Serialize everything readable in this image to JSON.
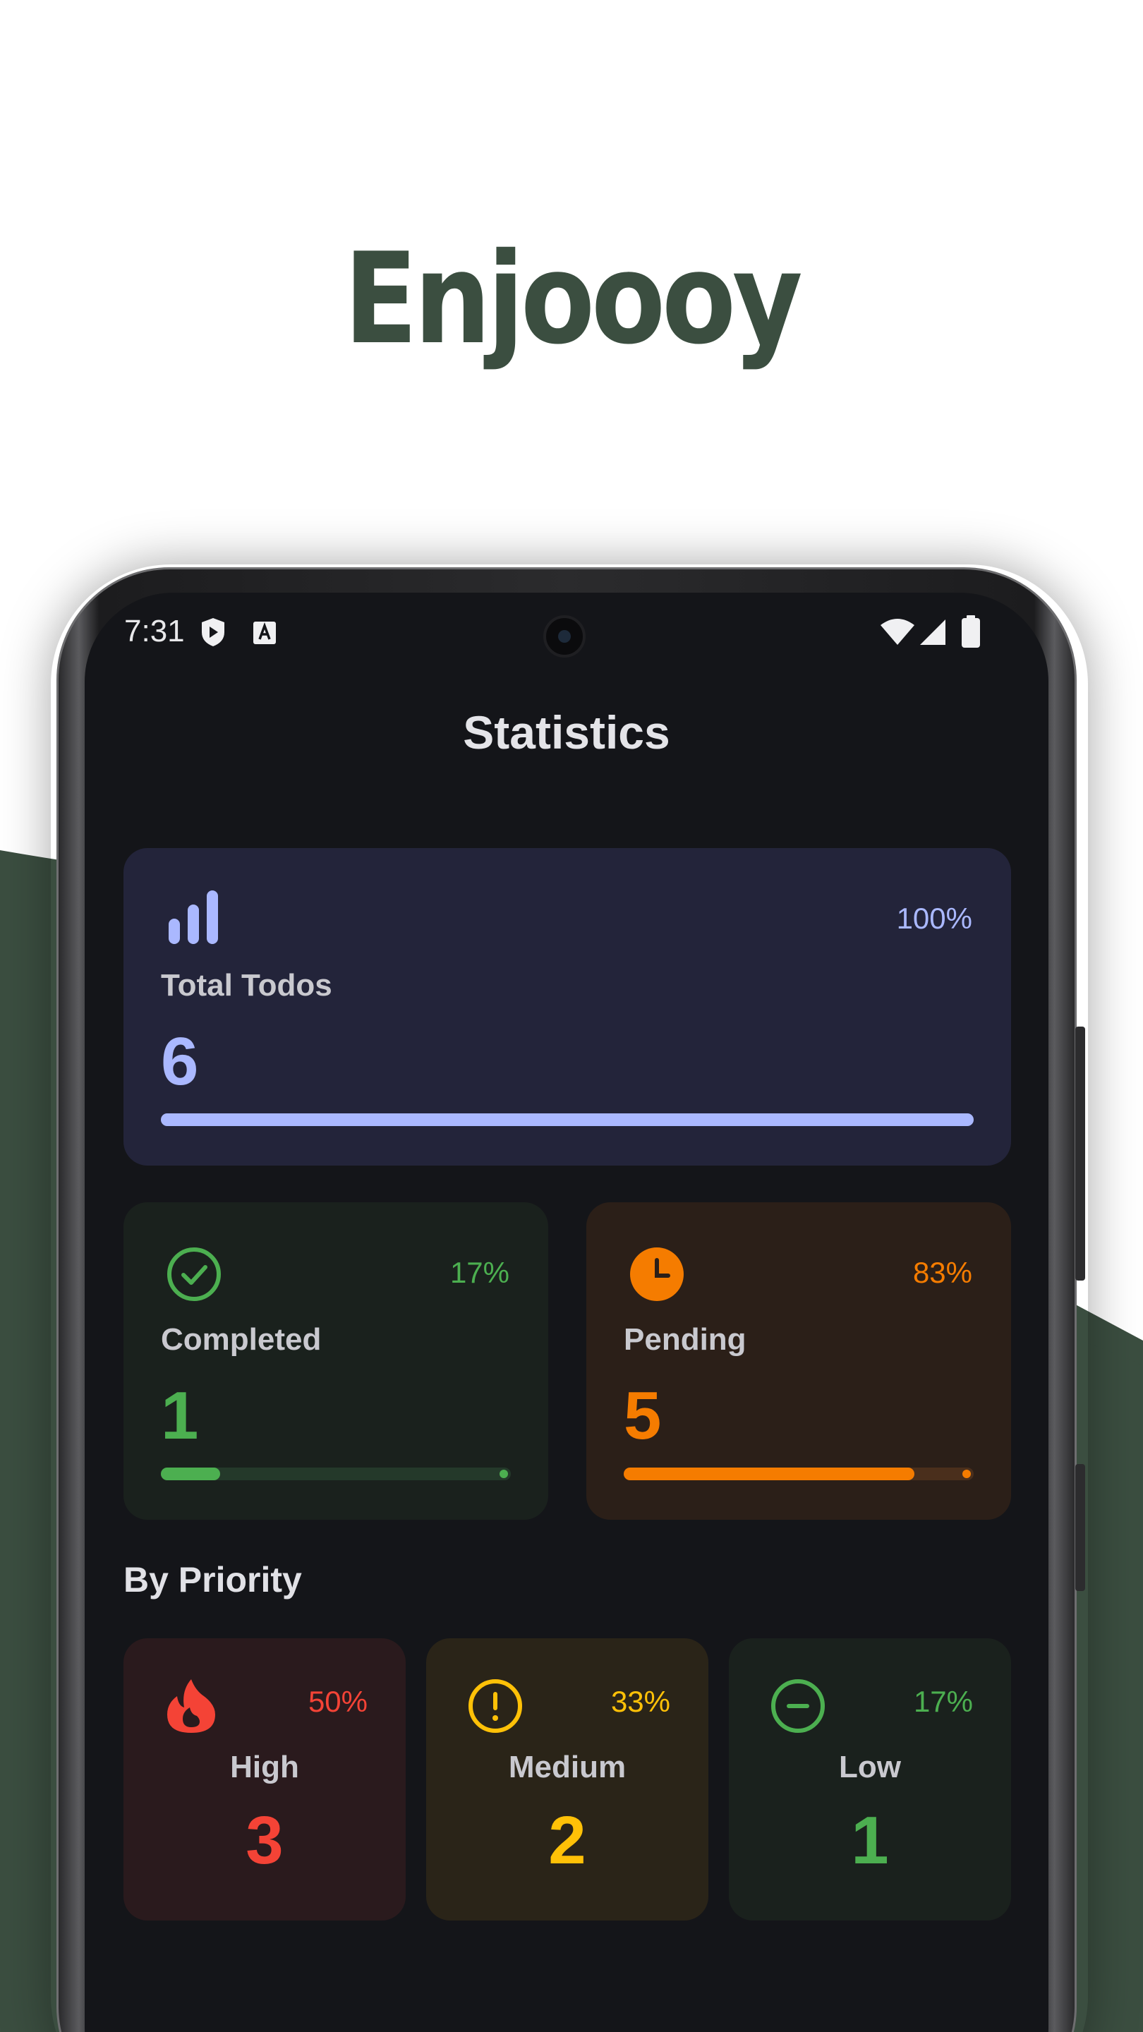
{
  "promo": {
    "headline": "Enjoooy",
    "colors": {
      "brand_green": "#3b4e40"
    }
  },
  "status_bar": {
    "time": "7:31",
    "left_icons": [
      "shield-icon",
      "keyboard-a-icon"
    ],
    "right_icons": [
      "wifi-icon",
      "signal-icon",
      "battery-icon"
    ]
  },
  "screen": {
    "title": "Statistics",
    "total": {
      "label": "Total Todos",
      "value": "6",
      "percent": "100%",
      "progress": 1.0,
      "icon": "bar-chart-icon",
      "color": "#aab8ff"
    },
    "completed": {
      "label": "Completed",
      "value": "1",
      "percent": "17%",
      "progress": 0.17,
      "icon": "check-circle-icon",
      "color": "#4caf50"
    },
    "pending": {
      "label": "Pending",
      "value": "5",
      "percent": "83%",
      "progress": 0.83,
      "icon": "clock-icon",
      "color": "#f57c00"
    },
    "priority_section_title": "By Priority",
    "priority": {
      "high": {
        "label": "High",
        "value": "3",
        "percent": "50%",
        "icon": "flame-icon",
        "color": "#f44336"
      },
      "medium": {
        "label": "Medium",
        "value": "2",
        "percent": "33%",
        "icon": "exclamation-circle-icon",
        "color": "#ffc107"
      },
      "low": {
        "label": "Low",
        "value": "1",
        "percent": "17%",
        "icon": "minus-circle-icon",
        "color": "#4caf50"
      }
    }
  }
}
